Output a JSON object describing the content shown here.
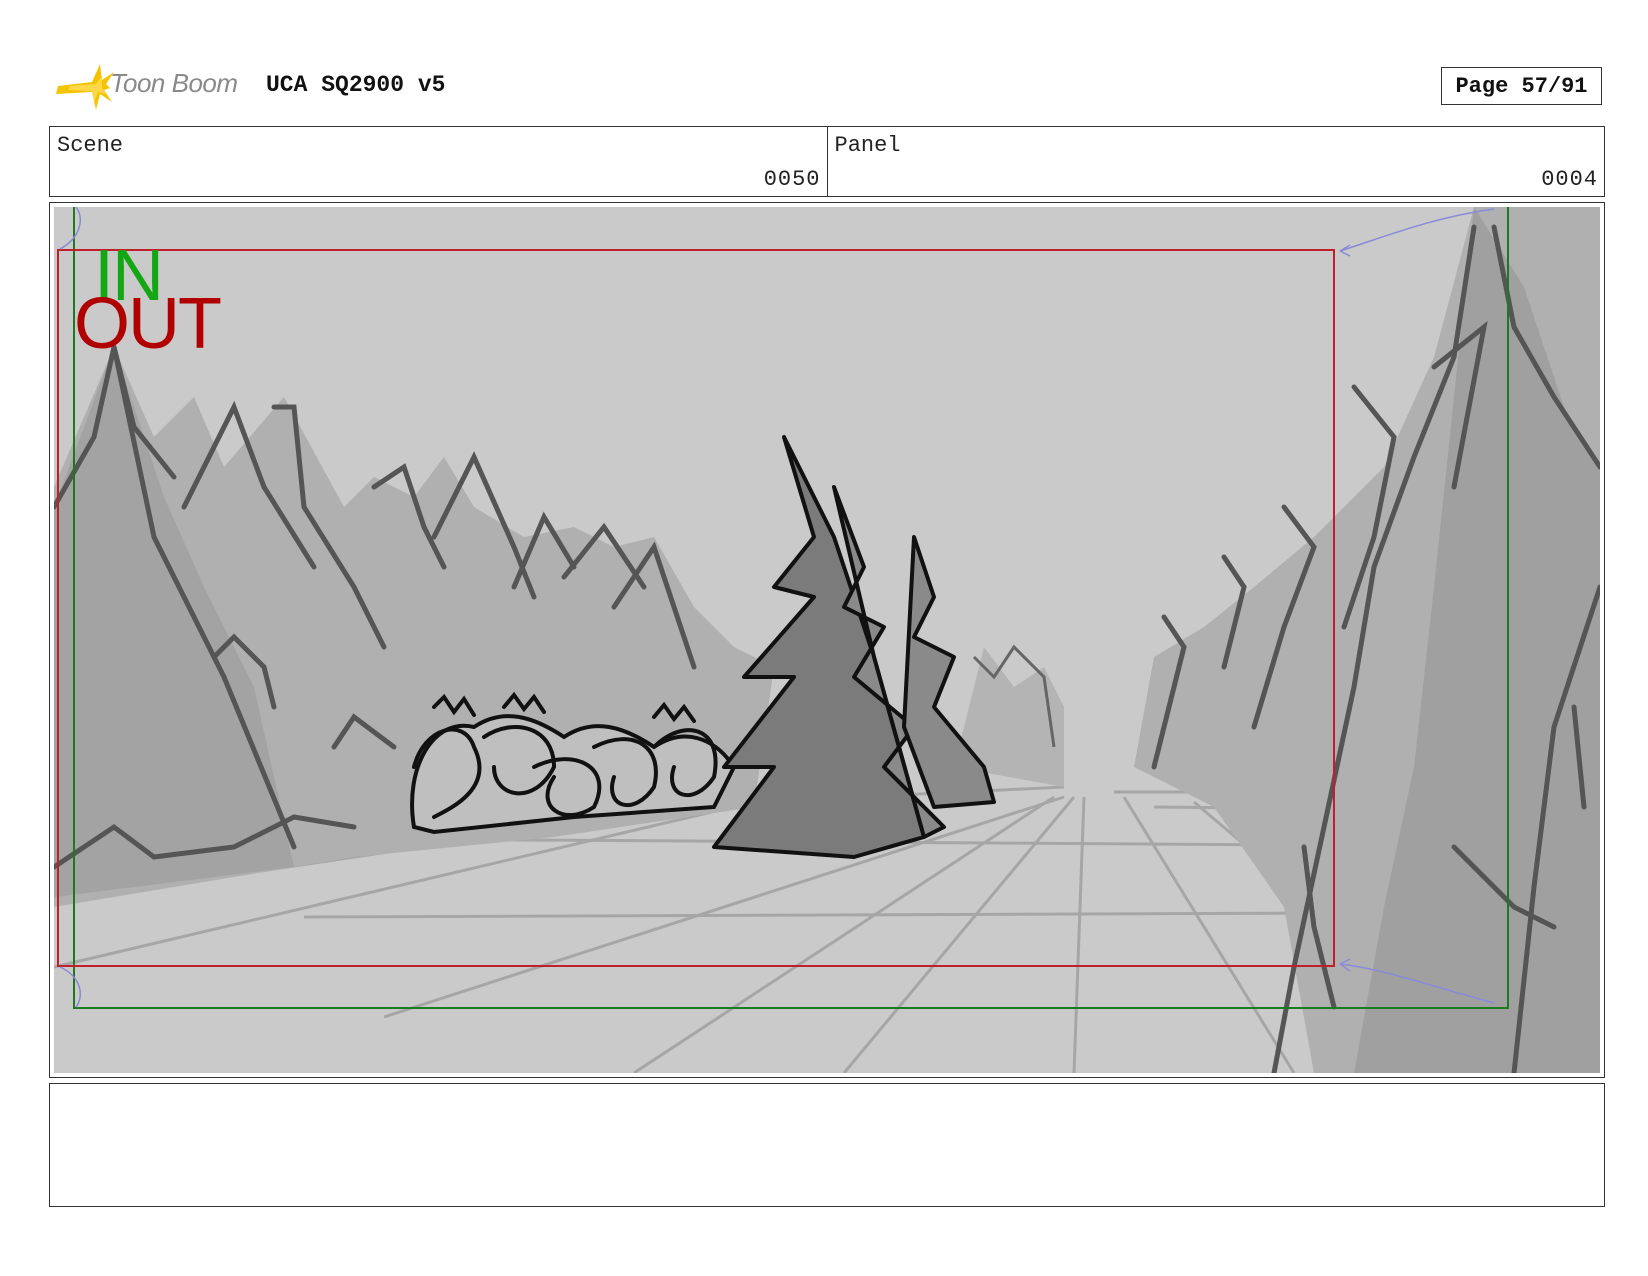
{
  "header": {
    "logo_text": "Toon Boom",
    "title": "UCA SQ2900 v5",
    "page": "Page 57/91"
  },
  "info": {
    "scene_label": "Scene",
    "scene_value": "0050",
    "panel_label": "Panel",
    "panel_value": "0004"
  },
  "frame_markers": {
    "in_label": "IN",
    "out_label": "OUT"
  },
  "colors": {
    "logo_star": "#f5c400",
    "in_frame": "#1e7a1e",
    "out_frame": "#c0202a",
    "in_text": "#13a813",
    "out_text": "#b00000",
    "panel_bg": "#c9c9c9"
  },
  "notes": ""
}
